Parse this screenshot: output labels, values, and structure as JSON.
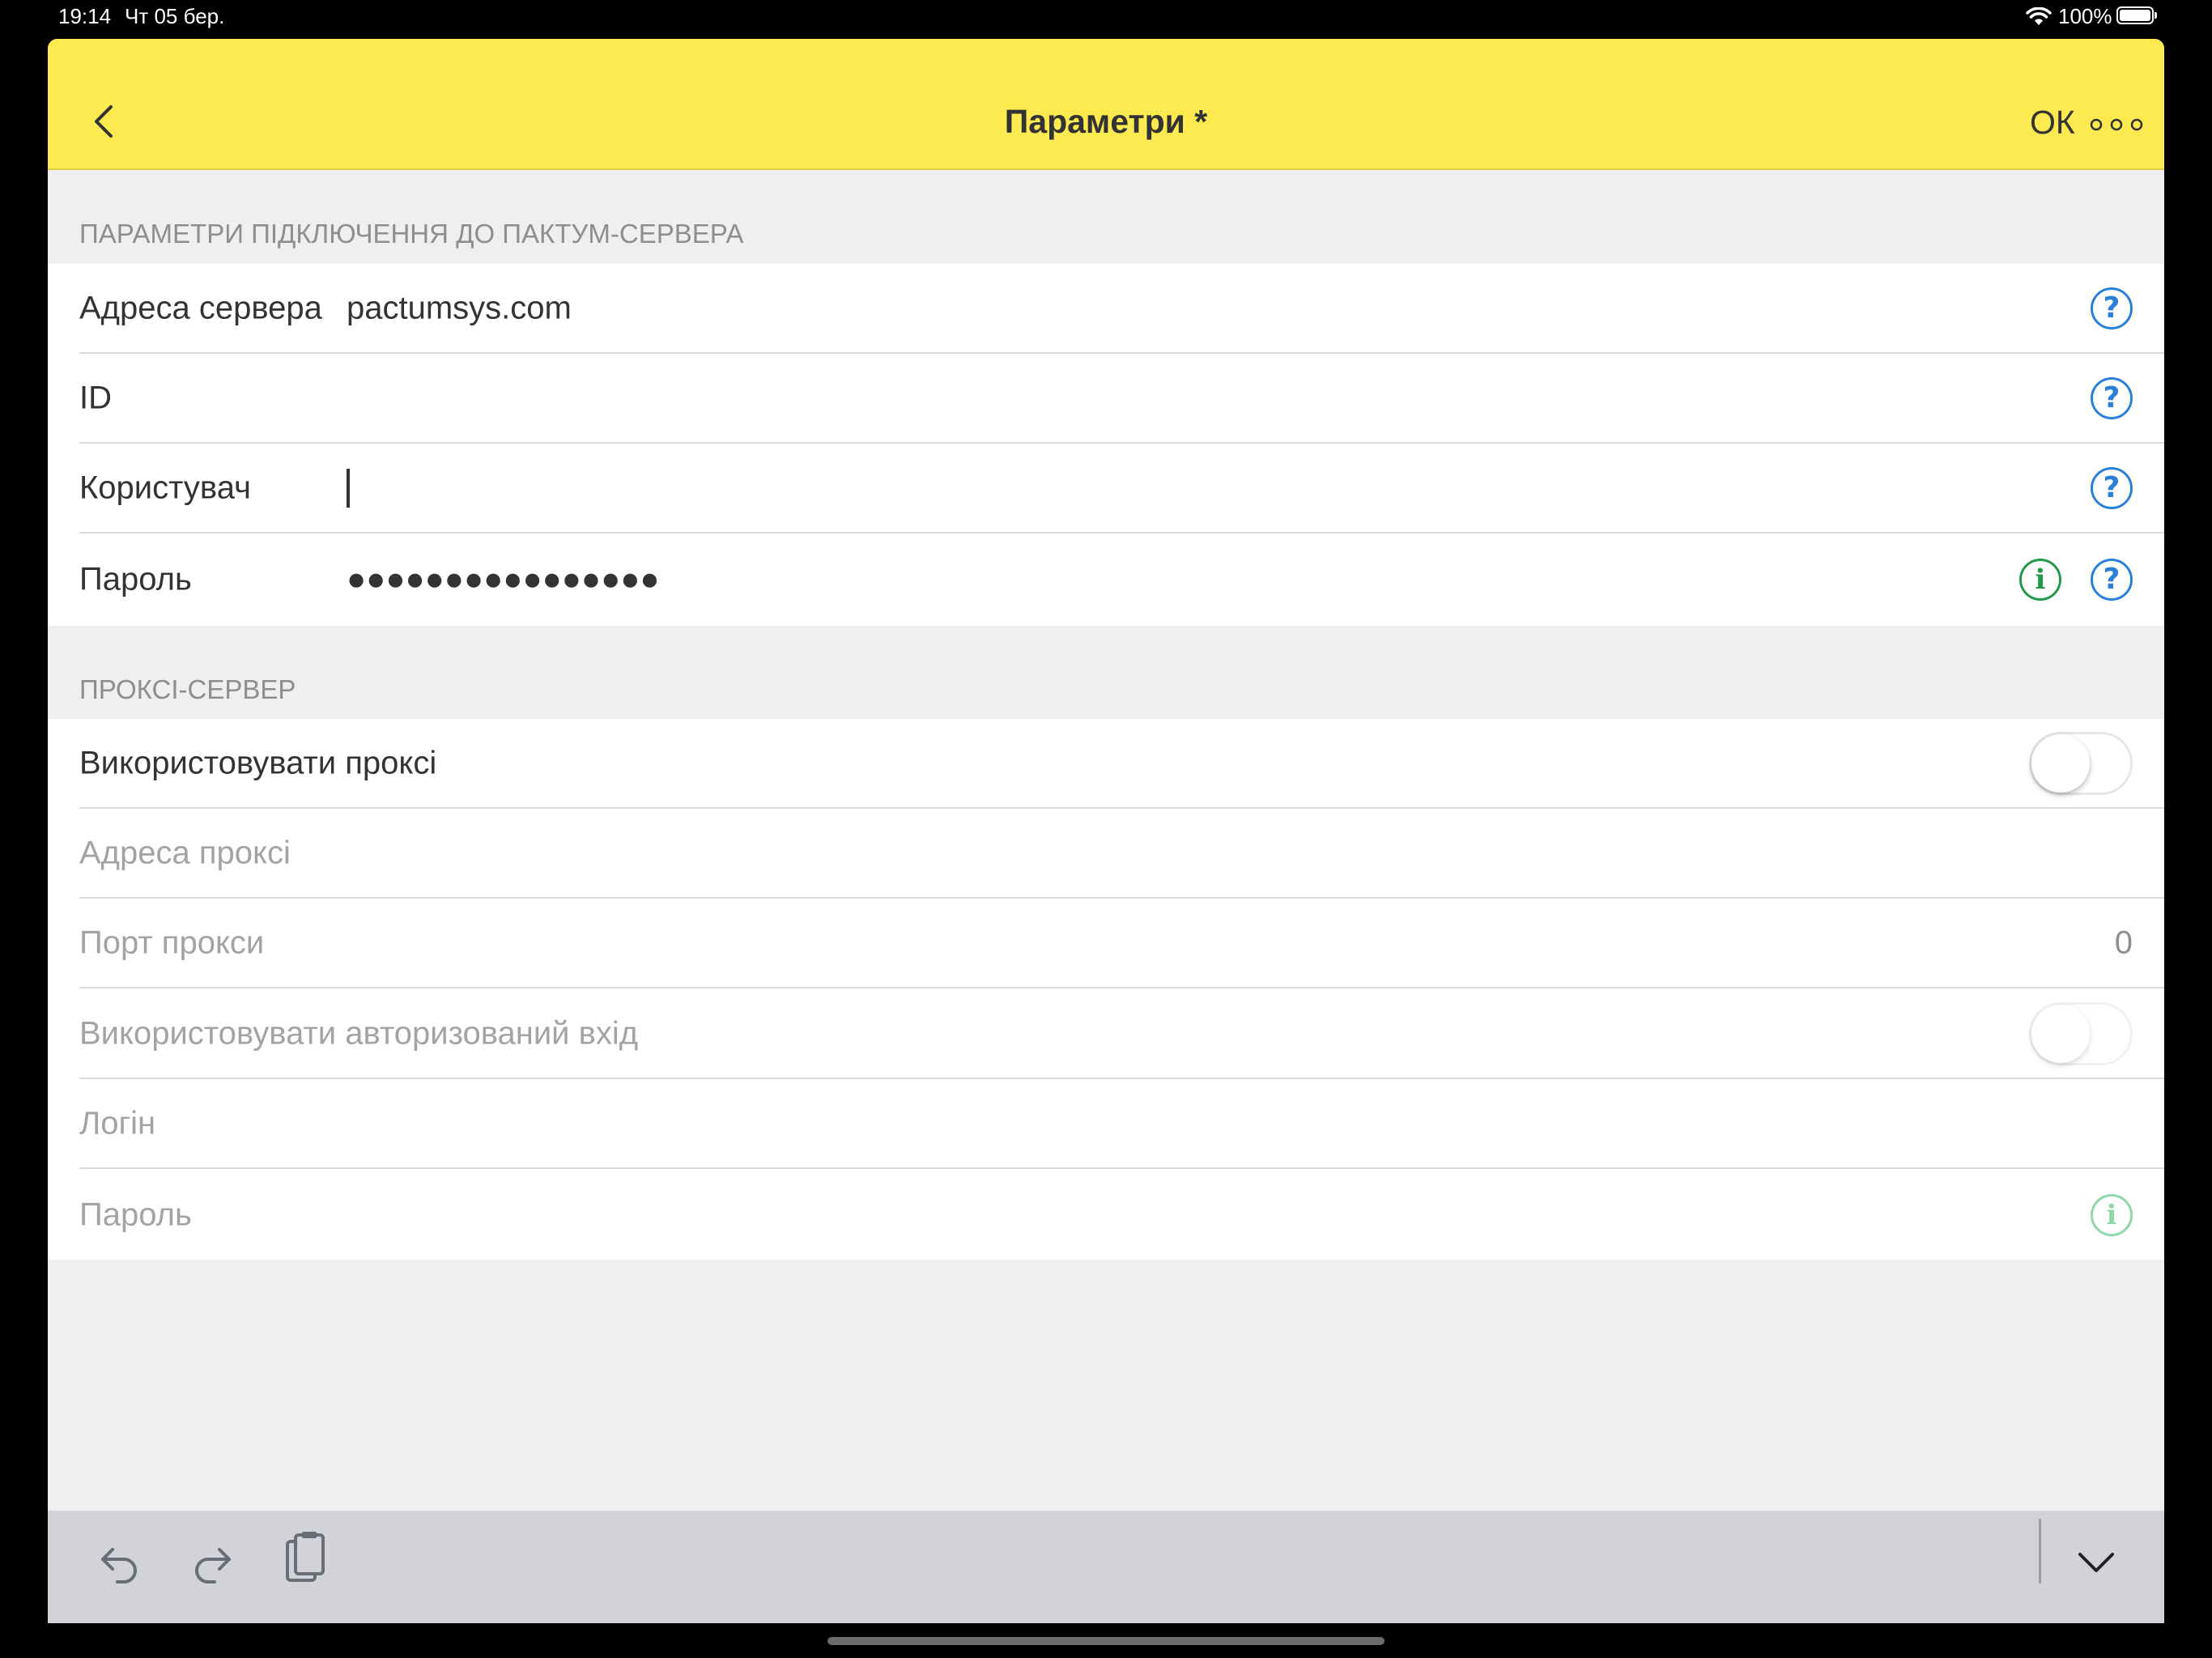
{
  "status_bar": {
    "time": "19:14",
    "date": "Чт 05 бер.",
    "battery_pct": "100%"
  },
  "header": {
    "title": "Параметри *",
    "ok_label": "ОК"
  },
  "connection": {
    "section_title": "ПАРАМЕТРИ ПІДКЛЮЧЕННЯ ДО ПАКТУМ-СЕРВЕРА",
    "server_address": {
      "label": "Адреса сервера",
      "value": "pactumsys.com"
    },
    "id": {
      "label": "ID",
      "value": ""
    },
    "user": {
      "label": "Користувач",
      "value": ""
    },
    "password": {
      "label": "Пароль",
      "value": "●●●●●●●●●●●●●●●●"
    }
  },
  "proxy": {
    "section_title": "ПРОКСІ-СЕРВЕР",
    "use_proxy": {
      "label": "Використовувати проксі",
      "on": false
    },
    "proxy_address": {
      "label": "Адреса проксі",
      "value": ""
    },
    "proxy_port": {
      "label": "Порт прокси",
      "value": "0"
    },
    "use_auth": {
      "label": "Використовувати авторизований вхід",
      "on": false
    },
    "login": {
      "label": "Логін",
      "value": ""
    },
    "password": {
      "label": "Пароль",
      "value": ""
    }
  },
  "colors": {
    "header_bg": "#fde950",
    "help_icon": "#2a7fd6",
    "info_icon": "#1e9a4a"
  }
}
